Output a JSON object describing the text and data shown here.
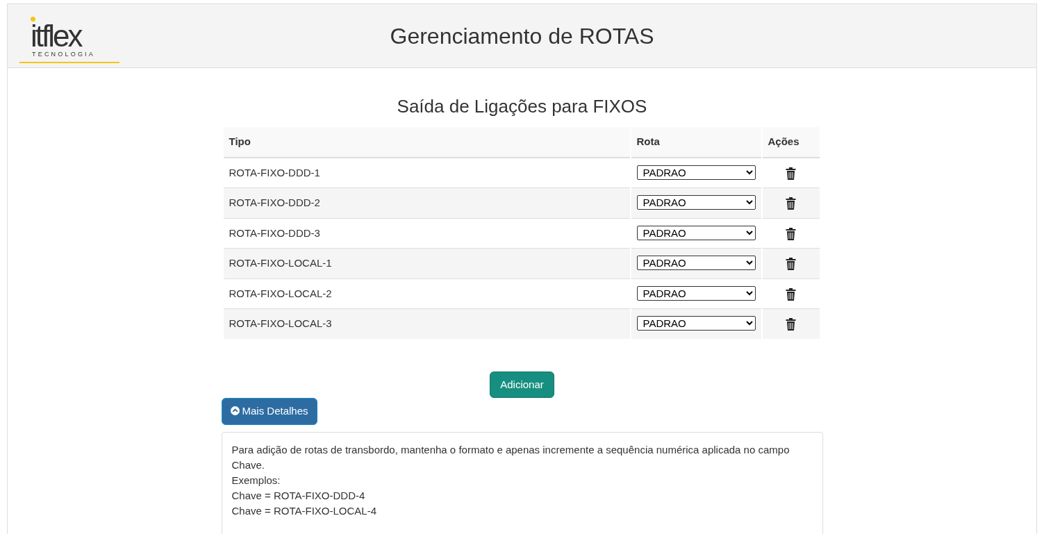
{
  "header": {
    "logo": {
      "brand": "itflex",
      "tagline": "TECNOLOGIA"
    },
    "title": "Gerenciamento de ROTAS"
  },
  "section_title": "Saída de Ligações para FIXOS",
  "table": {
    "columns": [
      "Tipo",
      "Rota",
      "Ações"
    ],
    "rows": [
      {
        "tipo": "ROTA-FIXO-DDD-1",
        "rota": "PADRAO"
      },
      {
        "tipo": "ROTA-FIXO-DDD-2",
        "rota": "PADRAO"
      },
      {
        "tipo": "ROTA-FIXO-DDD-3",
        "rota": "PADRAO"
      },
      {
        "tipo": "ROTA-FIXO-LOCAL-1",
        "rota": "PADRAO"
      },
      {
        "tipo": "ROTA-FIXO-LOCAL-2",
        "rota": "PADRAO"
      },
      {
        "tipo": "ROTA-FIXO-LOCAL-3",
        "rota": "PADRAO"
      }
    ]
  },
  "add_button": "Adicionar",
  "details": {
    "label": "Mais Detalhes",
    "expanded": true,
    "lines": [
      "Para adição de rotas de transbordo, mantenha o formato e apenas incremente a sequência numérica aplicada no campo Chave.",
      "Exemplos:",
      "Chave = ROTA-FIXO-DDD-4",
      "Chave = ROTA-FIXO-LOCAL-4"
    ]
  }
}
